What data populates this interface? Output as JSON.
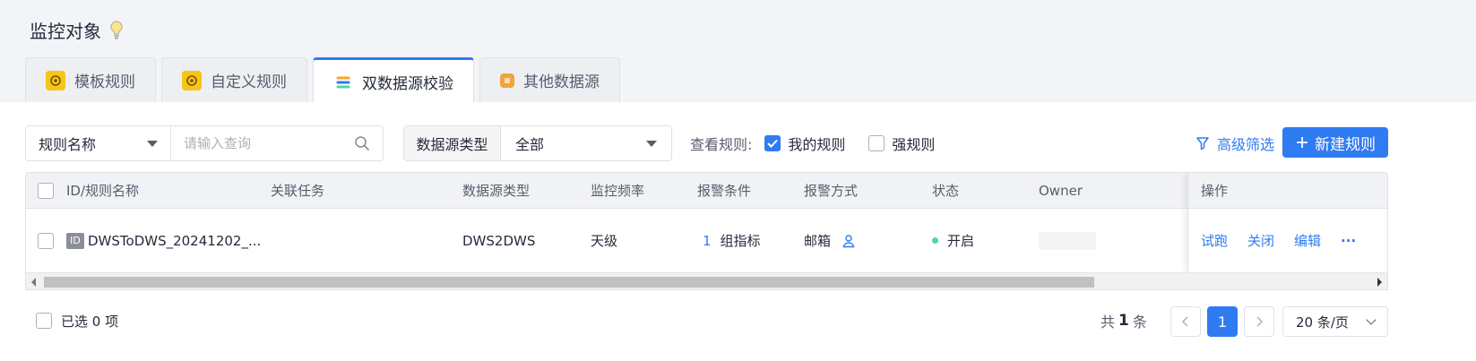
{
  "page": {
    "title": "监控对象"
  },
  "tabs": [
    {
      "label": "模板规则"
    },
    {
      "label": "自定义规则"
    },
    {
      "label": "双数据源校验"
    },
    {
      "label": "其他数据源"
    }
  ],
  "toolbar": {
    "field_select": "规则名称",
    "search_placeholder": "请输入查询",
    "datasource_label": "数据源类型",
    "datasource_value": "全部",
    "view_label": "查看规则:",
    "my_rules": "我的规则",
    "strong_rules": "强规则",
    "advanced_filter": "高级筛选",
    "new_rule": "新建规则"
  },
  "table": {
    "columns": [
      "ID/规则名称",
      "关联任务",
      "数据源类型",
      "监控频率",
      "报警条件",
      "报警方式",
      "状态",
      "Owner",
      "操作"
    ],
    "rows": [
      {
        "id_tag": "ID",
        "name": "DWSToDWS_20241202_...",
        "task": "",
        "datasource": "DWS2DWS",
        "frequency": "天级",
        "alarm_count": "1",
        "alarm_unit": "组指标",
        "alarm_method": "邮箱",
        "status": "开启",
        "owner": "",
        "actions": [
          "试跑",
          "关闭",
          "编辑",
          "···"
        ]
      }
    ]
  },
  "footer": {
    "selected": "已选 0 项",
    "total_prefix": "共",
    "total_count": "1",
    "total_suffix": "条",
    "current_page": "1",
    "page_size": "20 条/页"
  },
  "colors": {
    "primary": "#2f7bf2",
    "status_on": "#50d4ab"
  }
}
